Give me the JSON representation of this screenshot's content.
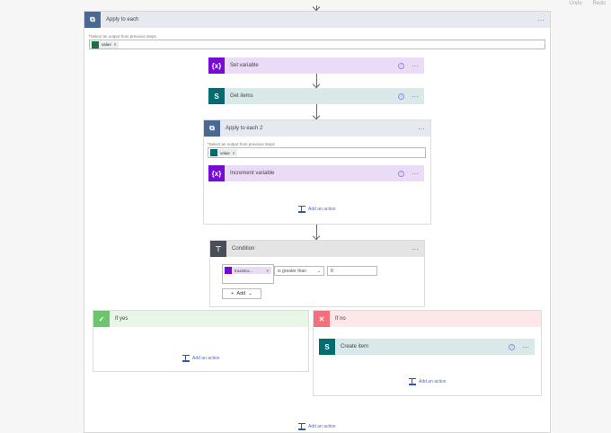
{
  "toolbar": {
    "undo": "Undo",
    "redo": "Redo"
  },
  "apply_each": {
    "title": "Apply to each",
    "label": "Select an output from previous steps",
    "token": "value"
  },
  "set_variable": {
    "title": "Set variable"
  },
  "get_items": {
    "title": "Get items"
  },
  "apply_each_2": {
    "title": "Apply to each 2",
    "label": "Select an output from previous steps",
    "token": "value",
    "add_action": "Add an action"
  },
  "increment_variable": {
    "title": "Increment variable"
  },
  "condition": {
    "title": "Condition",
    "token": "InListCo...",
    "operator": "is greater than",
    "value": "0",
    "add": "Add"
  },
  "if_yes": {
    "title": "If yes",
    "add_action": "Add an action"
  },
  "if_no": {
    "title": "If no",
    "add_action": "Add an action"
  },
  "create_item": {
    "title": "Create item"
  },
  "bottom": {
    "add_action": "Add an action"
  },
  "colors": {
    "loop": "#486991",
    "variable": "#770bd6",
    "sharepoint": "#036c70",
    "condition": "#484f58",
    "yes": "#6cc46c",
    "no": "#f1707b"
  }
}
